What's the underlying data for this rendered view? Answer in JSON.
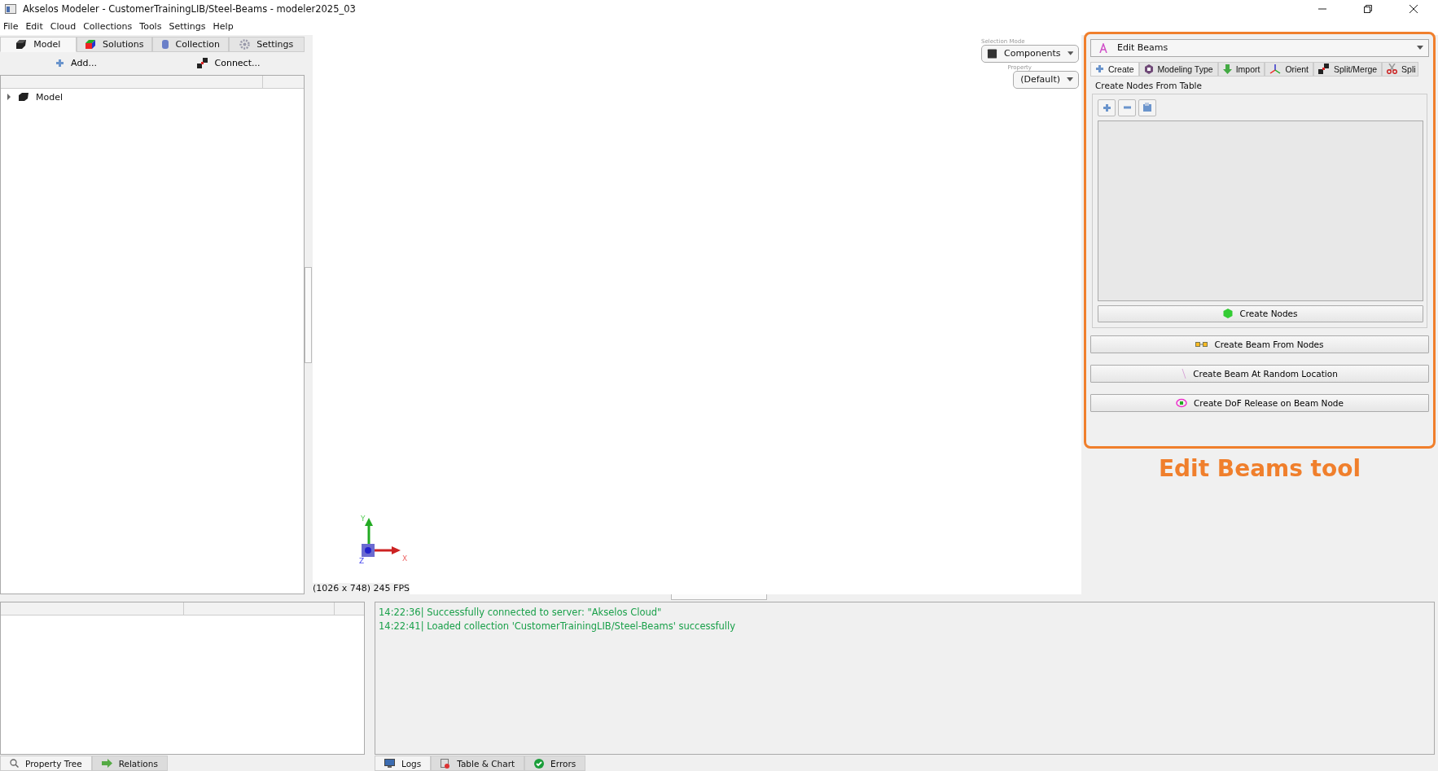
{
  "window": {
    "title": "Akselos Modeler - CustomerTrainingLIB/Steel-Beams - modeler2025_03"
  },
  "menu": [
    {
      "label": "File"
    },
    {
      "label": "Edit"
    },
    {
      "label": "Cloud"
    },
    {
      "label": "Collections"
    },
    {
      "label": "Tools"
    },
    {
      "label": "Settings"
    },
    {
      "label": "Help"
    }
  ],
  "left_tabs": [
    {
      "label": "Model",
      "selected": true
    },
    {
      "label": "Solutions",
      "selected": false
    },
    {
      "label": "Collection",
      "selected": false
    },
    {
      "label": "Settings",
      "selected": false
    }
  ],
  "toolbar": [
    {
      "label": "Add..."
    },
    {
      "label": "Connect..."
    }
  ],
  "tree": [
    {
      "label": "Model",
      "expanded": false
    }
  ],
  "viewport": {
    "selection_mode_label": "Selection Mode",
    "selection_mode": "Components",
    "property_label": "Property",
    "property": "(Default)",
    "axis_x": "X",
    "axis_y": "Y",
    "axis_z": "Z",
    "stats": "(1026 x 748) 245 FPS"
  },
  "tool_panel": {
    "tool": "Edit Beams",
    "tabs": [
      {
        "label": "Create",
        "selected": true
      },
      {
        "label": "Modeling Type",
        "selected": false
      },
      {
        "label": "Import",
        "selected": false
      },
      {
        "label": "Orient",
        "selected": false
      },
      {
        "label": "Split/Merge",
        "selected": false
      },
      {
        "label": "Spli",
        "selected": false
      }
    ],
    "section": "Create Nodes From Table",
    "create_nodes": "Create Nodes",
    "buttons": [
      {
        "label": "Create Beam From Nodes"
      },
      {
        "label": "Create Beam At Random Location"
      },
      {
        "label": "Create DoF Release on Beam Node"
      }
    ]
  },
  "annotation": "Edit Beams tool",
  "bottom_left_tabs": [
    {
      "label": "Property Tree",
      "selected": true
    },
    {
      "label": "Relations",
      "selected": false
    }
  ],
  "log": [
    "14:22:36| Successfully connected to server: \"Akselos Cloud\"",
    "14:22:41| Loaded collection 'CustomerTrainingLIB/Steel-Beams' successfully"
  ],
  "bottom_tabs": [
    {
      "label": "Logs",
      "selected": true
    },
    {
      "label": "Table & Chart",
      "selected": false
    },
    {
      "label": "Errors",
      "selected": false
    }
  ]
}
